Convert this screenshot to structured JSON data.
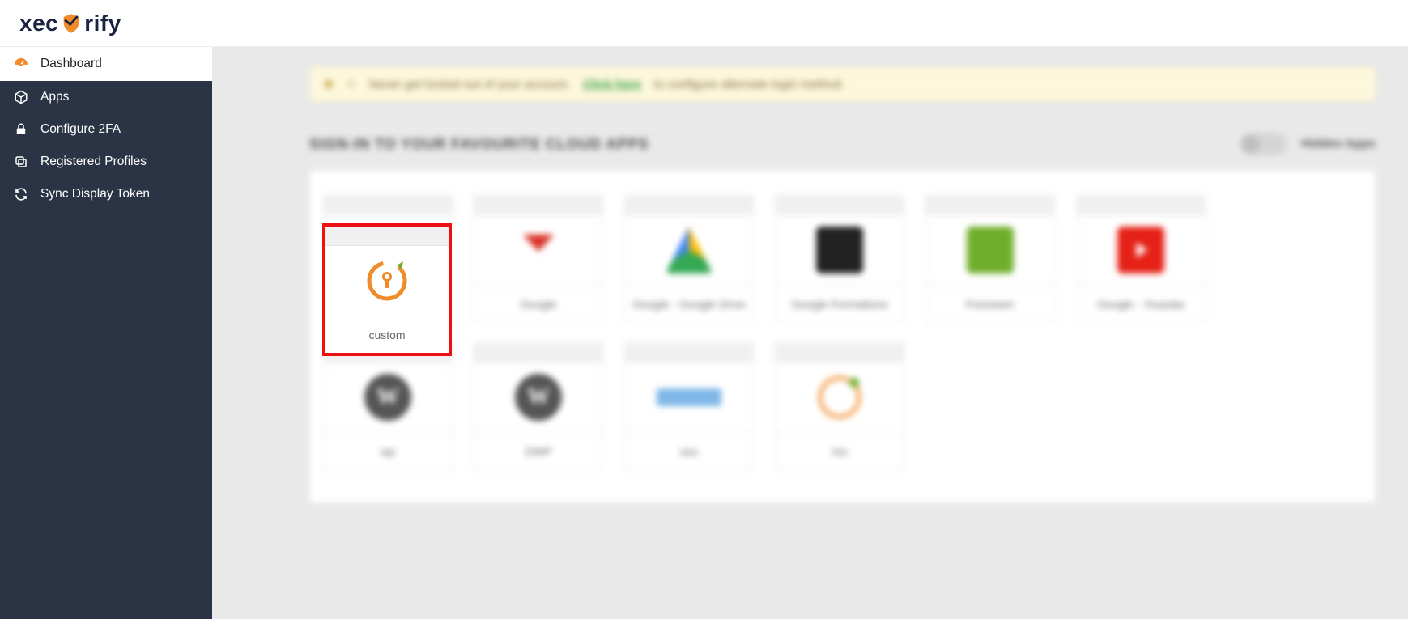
{
  "brand": {
    "name_left": "xec",
    "name_right": "rify"
  },
  "sidebar": {
    "items": [
      {
        "label": "Dashboard",
        "icon": "gauge-icon",
        "active": true
      },
      {
        "label": "Apps",
        "icon": "cube-icon",
        "active": false
      },
      {
        "label": "Configure 2FA",
        "icon": "lock-icon",
        "active": false
      },
      {
        "label": "Registered Profiles",
        "icon": "copy-icon",
        "active": false
      },
      {
        "label": "Sync Display Token",
        "icon": "sync-icon",
        "active": false
      }
    ]
  },
  "alert": {
    "pre": "Never get locked out of your account.",
    "link": "Click here",
    "post": "to configure alternate login method."
  },
  "section": {
    "title": "SIGN-IN TO YOUR FAVOURITE CLOUD APPS",
    "toggle_label": "Hidden Apps"
  },
  "apps_row1": [
    {
      "label": "custom",
      "icon": "custom",
      "highlight": true
    },
    {
      "label": "Google",
      "icon": "gmail"
    },
    {
      "label": "Google - Google Drive",
      "icon": "drive"
    },
    {
      "label": "Google Formations",
      "icon": "dark"
    },
    {
      "label": "Foreseen",
      "icon": "green"
    },
    {
      "label": "Google - Youtube",
      "icon": "youtube"
    }
  ],
  "apps_row2": [
    {
      "label": "wp",
      "icon": "wp"
    },
    {
      "label": "DWP",
      "icon": "wp"
    },
    {
      "label": "sso",
      "icon": "blurtext"
    },
    {
      "label": "mo",
      "icon": "mo"
    }
  ]
}
